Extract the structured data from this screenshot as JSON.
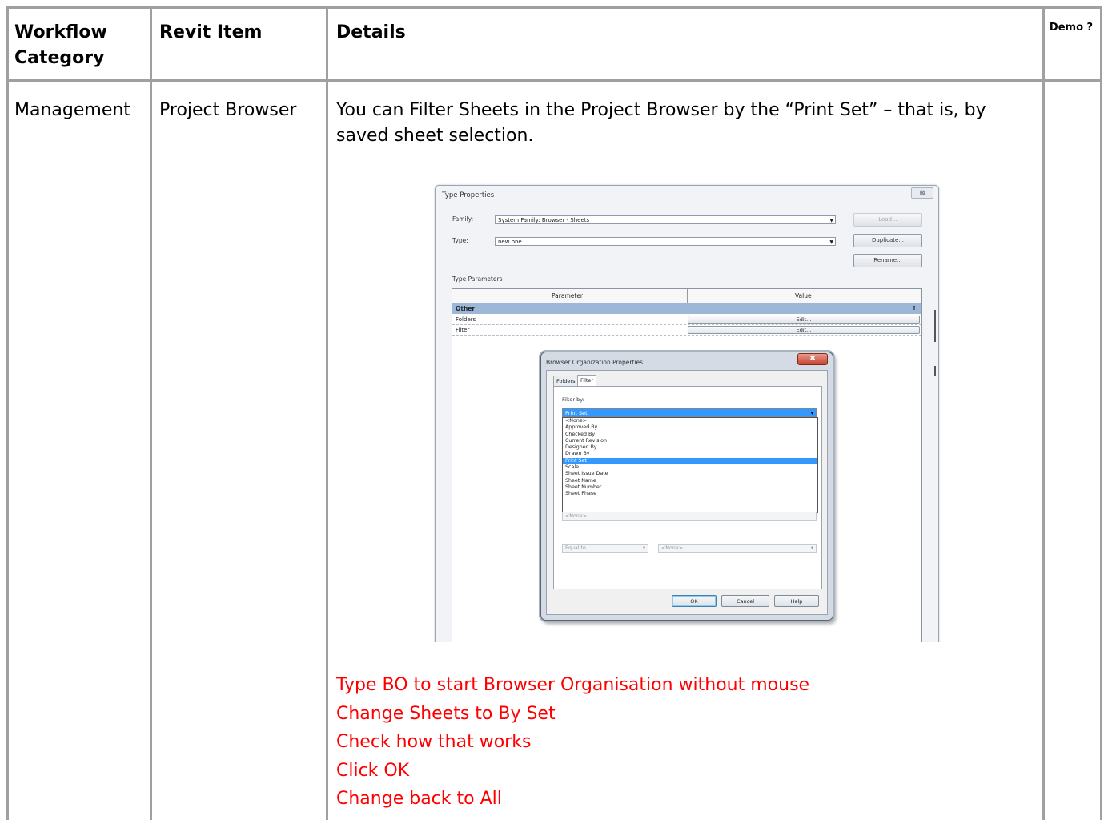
{
  "table": {
    "headers": {
      "workflow_category": "Workflow Category",
      "revit_item": "Revit Item",
      "details": "Details",
      "demo": "Demo ?"
    },
    "row": {
      "workflow_category": "Management",
      "revit_item": "Project Browser",
      "details_text": "You can Filter Sheets in the Project Browser by the “Print Set” – that is, by saved sheet selection.",
      "demo": "",
      "notes_color": "#ff0000",
      "notes": [
        "Type BO to start Browser Organisation without mouse",
        "Change Sheets to By Set",
        "Check how that works",
        "Click OK",
        "Change back to All"
      ]
    }
  },
  "screenshot": {
    "type_properties": {
      "title": "Type Properties",
      "close_glyph": "⊠",
      "family_label": "Family:",
      "family_value": "System Family: Browser - Sheets",
      "type_label": "Type:",
      "type_value": "new one",
      "load_button": "Load...",
      "duplicate_button": "Duplicate...",
      "rename_button": "Rename...",
      "section_label": "Type Parameters",
      "col_parameter": "Parameter",
      "col_value": "Value",
      "group_label": "Other",
      "rows": [
        {
          "name": "Folders",
          "button": "Edit..."
        },
        {
          "name": "Filter",
          "button": "Edit..."
        }
      ]
    },
    "browser_org": {
      "title": "Browser Organization Properties",
      "close_glyph": "✖",
      "tabs": [
        "Folders",
        "Filter"
      ],
      "active_tab": "Filter",
      "filter_by_label": "Filter by:",
      "selected": "Print Set",
      "options": [
        "<None>",
        "Approved By",
        "Checked By",
        "Current Revision",
        "Designed By",
        "Drawn By",
        "Print Set",
        "Scale",
        "Sheet Issue Date",
        "Sheet Name",
        "Sheet Number",
        "Sheet Phase"
      ],
      "below_list_value": "<None>",
      "operator_value": "Equal to",
      "value_value": "<None>",
      "ok_button": "OK",
      "cancel_button": "Cancel",
      "help_button": "Help"
    }
  }
}
